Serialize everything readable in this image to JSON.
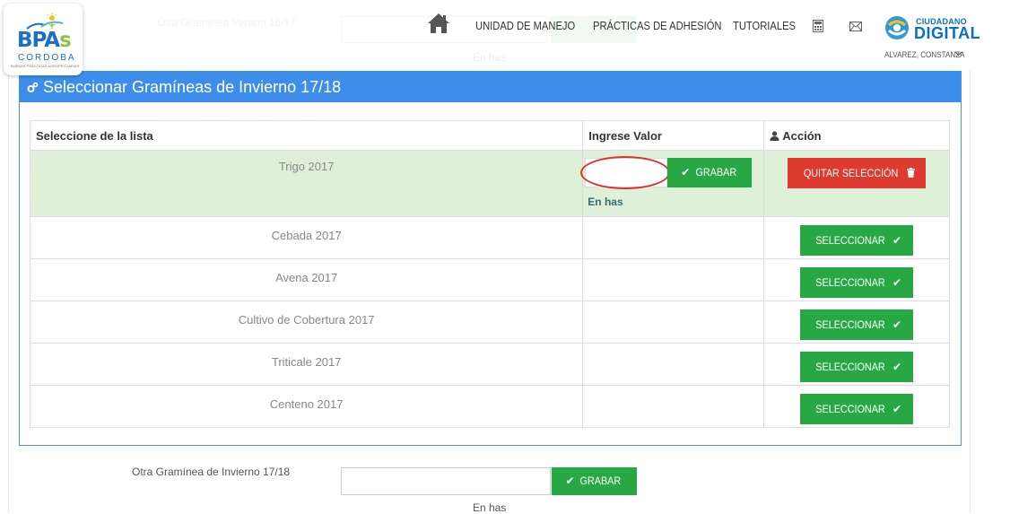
{
  "brand": {
    "logo_text": "BPA",
    "logo_text_s": "s",
    "logo_region": "CORDOBA",
    "logo_tagline": "BUENAS PRÁCTICAS AGROPECUARIAS"
  },
  "background_faded": {
    "title": "Otra Gramínea Verano 16/17",
    "unit": "En has"
  },
  "nav": {
    "items": [
      {
        "label": "UNIDAD DE MANEJO"
      },
      {
        "label": "PRÁCTICAS DE ADHESIÓN"
      },
      {
        "label": "TUTORIALES"
      }
    ],
    "portal_small": "CIUDADANO",
    "portal_big": "DIGITAL",
    "user_name": "ALVAREZ, CONSTANZA"
  },
  "panel": {
    "title": "Seleccionar Gramíneas de Invierno 17/18",
    "columns": {
      "list": "Seleccione de la lista",
      "value": "Ingrese Valor",
      "action": "Acción"
    },
    "selected": {
      "name": "Trigo 2017",
      "save_label": "GRABAR",
      "unit": "En has",
      "remove_label": "QUITAR SELECCIÓN"
    },
    "rows": [
      {
        "name": "Cebada 2017",
        "action": "SELECCIONAR"
      },
      {
        "name": "Avena 2017",
        "action": "SELECCIONAR"
      },
      {
        "name": "Cultivo de Cobertura 2017",
        "action": "SELECCIONAR"
      },
      {
        "name": "Triticale 2017",
        "action": "SELECCIONAR"
      },
      {
        "name": "Centeno 2017",
        "action": "SELECCIONAR"
      }
    ]
  },
  "other": {
    "label": "Otra Gramínea de Invierno 17/18",
    "save_label": "GRABAR",
    "unit": "En has"
  },
  "colors": {
    "primary": "#3d8eea",
    "success": "#28a745",
    "danger": "#dd3b2f",
    "selected_row": "#dff0d8",
    "highlight_oval": "#e03131"
  }
}
